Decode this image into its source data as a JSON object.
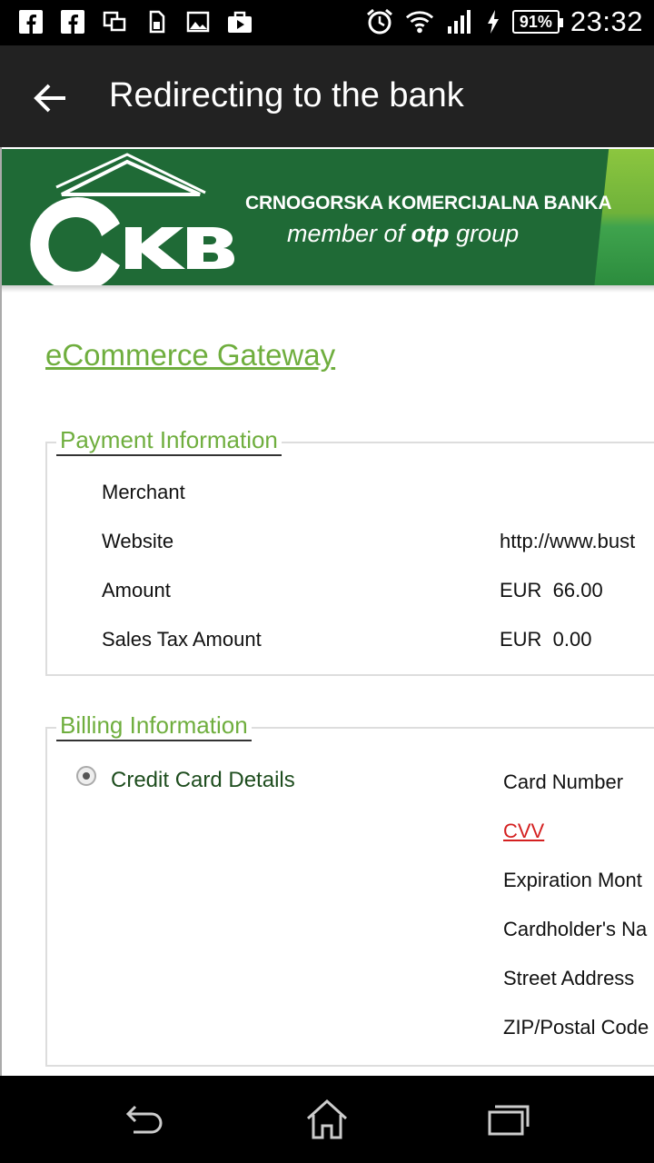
{
  "status_bar": {
    "left_icons": [
      "facebook-icon",
      "facebook-icon",
      "screenshot-icon",
      "sim-icon",
      "image-icon",
      "bag-icon"
    ],
    "right_icons": [
      "alarm-icon",
      "wifi-icon",
      "signal-icon",
      "charging-icon"
    ],
    "battery": "91%",
    "time": "23:32"
  },
  "action_bar": {
    "title": "Redirecting to the bank"
  },
  "bank": {
    "name": "CRNOGORSKA KOMERCIJALNA BANKA",
    "member_of": "member of",
    "otp": "otp",
    "group": "group"
  },
  "page": {
    "gateway_link": "eCommerce Gateway"
  },
  "payment": {
    "legend": "Payment Information",
    "rows": [
      {
        "label": "Merchant",
        "value": ""
      },
      {
        "label": "Website",
        "value": "http://www.bust"
      },
      {
        "label": "Amount",
        "value": "EUR  66.00"
      },
      {
        "label": "Sales Tax Amount",
        "value": "EUR  0.00"
      }
    ]
  },
  "billing": {
    "legend": "Billing Information",
    "option": "Credit Card Details",
    "fields": [
      "Card Number",
      "CVV",
      "Expiration Mont",
      "Cardholder's Na",
      "Street Address",
      "ZIP/Postal Code"
    ]
  },
  "colors": {
    "accent_green": "#6fae3e",
    "bank_green": "#1f6a36",
    "cvv_red": "#d42020"
  }
}
